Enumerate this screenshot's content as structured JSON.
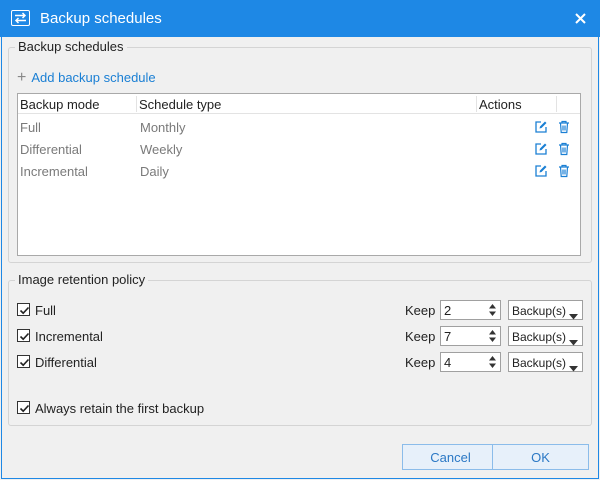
{
  "window": {
    "title": "Backup schedules",
    "icon": "transfer-arrows-icon",
    "accent_color": "#1e88e5"
  },
  "schedules_group": {
    "legend": "Backup schedules",
    "add_label": "Add backup schedule",
    "columns": [
      "Backup mode",
      "Schedule type",
      "Actions"
    ],
    "rows": [
      {
        "mode": "Full",
        "schedule": "Monthly"
      },
      {
        "mode": "Differential",
        "schedule": "Weekly"
      },
      {
        "mode": "Incremental",
        "schedule": "Daily"
      }
    ]
  },
  "retention_group": {
    "legend": "Image retention policy",
    "keep_label": "Keep",
    "items": [
      {
        "label": "Full",
        "checked": true,
        "count": "2",
        "unit": "Backup(s)"
      },
      {
        "label": "Incremental",
        "checked": true,
        "count": "7",
        "unit": "Backup(s)"
      },
      {
        "label": "Differential",
        "checked": true,
        "count": "4",
        "unit": "Backup(s)"
      }
    ],
    "retain_first": {
      "label": "Always retain the first backup",
      "checked": true
    }
  },
  "buttons": {
    "cancel": "Cancel",
    "ok": "OK"
  }
}
